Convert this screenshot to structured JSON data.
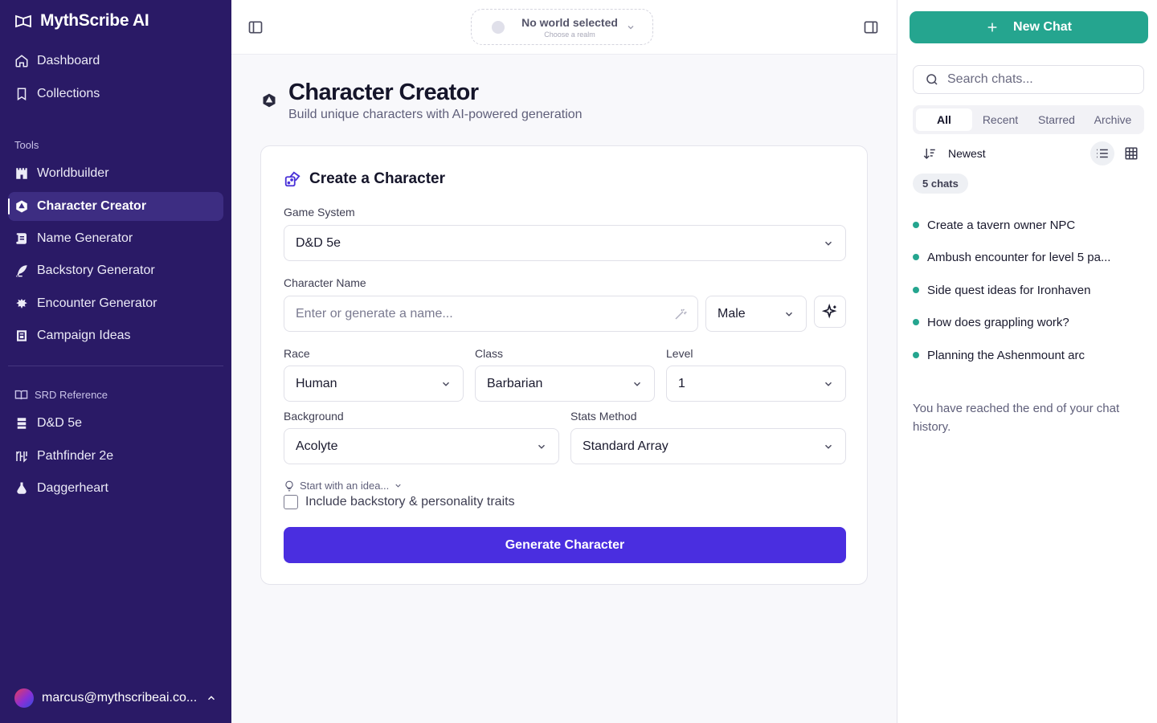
{
  "sidebar": {
    "brand": "MythScribe AI",
    "main_items": [
      {
        "label": "Dashboard",
        "icon": "home-icon"
      },
      {
        "label": "Collections",
        "icon": "bookmark-icon"
      }
    ],
    "tools_label": "Tools",
    "tools": [
      {
        "label": "Worldbuilder",
        "icon": "castle-icon"
      },
      {
        "label": "Character Creator",
        "icon": "d20-icon",
        "active": true
      },
      {
        "label": "Name Generator",
        "icon": "scroll-icon"
      },
      {
        "label": "Backstory Generator",
        "icon": "quill-icon"
      },
      {
        "label": "Encounter Generator",
        "icon": "dragon-icon"
      },
      {
        "label": "Campaign Ideas",
        "icon": "map-icon"
      }
    ],
    "srd_label": "SRD Reference",
    "srd": [
      {
        "label": "D&D 5e",
        "icon": "book-stack-icon"
      },
      {
        "label": "Pathfinder 2e",
        "icon": "runes-icon"
      },
      {
        "label": "Daggerheart",
        "icon": "potion-icon"
      }
    ],
    "user_email": "marcus@mythscribeai.co..."
  },
  "topbar": {
    "world_title": "No world selected",
    "world_sub": "Choose a realm"
  },
  "page": {
    "title": "Character Creator",
    "subtitle": "Build unique characters with AI-powered generation"
  },
  "form": {
    "card_title": "Create a Character",
    "game_system_label": "Game System",
    "game_system_value": "D&D 5e",
    "name_label": "Character Name",
    "name_placeholder": "Enter or generate a name...",
    "gender_value": "Male",
    "race_label": "Race",
    "race_value": "Human",
    "class_label": "Class",
    "class_value": "Barbarian",
    "level_label": "Level",
    "level_value": "1",
    "background_label": "Background",
    "background_value": "Acolyte",
    "stats_label": "Stats Method",
    "stats_value": "Standard Array",
    "idea_label": "Start with an idea...",
    "backstory_label": "Include backstory & personality traits",
    "generate_label": "Generate Character"
  },
  "chats": {
    "new_chat_label": "New Chat",
    "search_placeholder": "Search chats...",
    "tabs": [
      "All",
      "Recent",
      "Starred",
      "Archive"
    ],
    "sort_label": "Newest",
    "count_label": "5 chats",
    "items": [
      "Create a tavern owner NPC",
      "Ambush encounter for level 5 pa...",
      "Side quest ideas for Ironhaven",
      "How does grappling work?",
      "Planning the Ashenmount arc"
    ],
    "end_note": "You have reached the end of your chat history."
  },
  "colors": {
    "sidebar_bg": "#2a1a66",
    "primary": "#4a2ee0",
    "accent_teal": "#25a58f"
  }
}
